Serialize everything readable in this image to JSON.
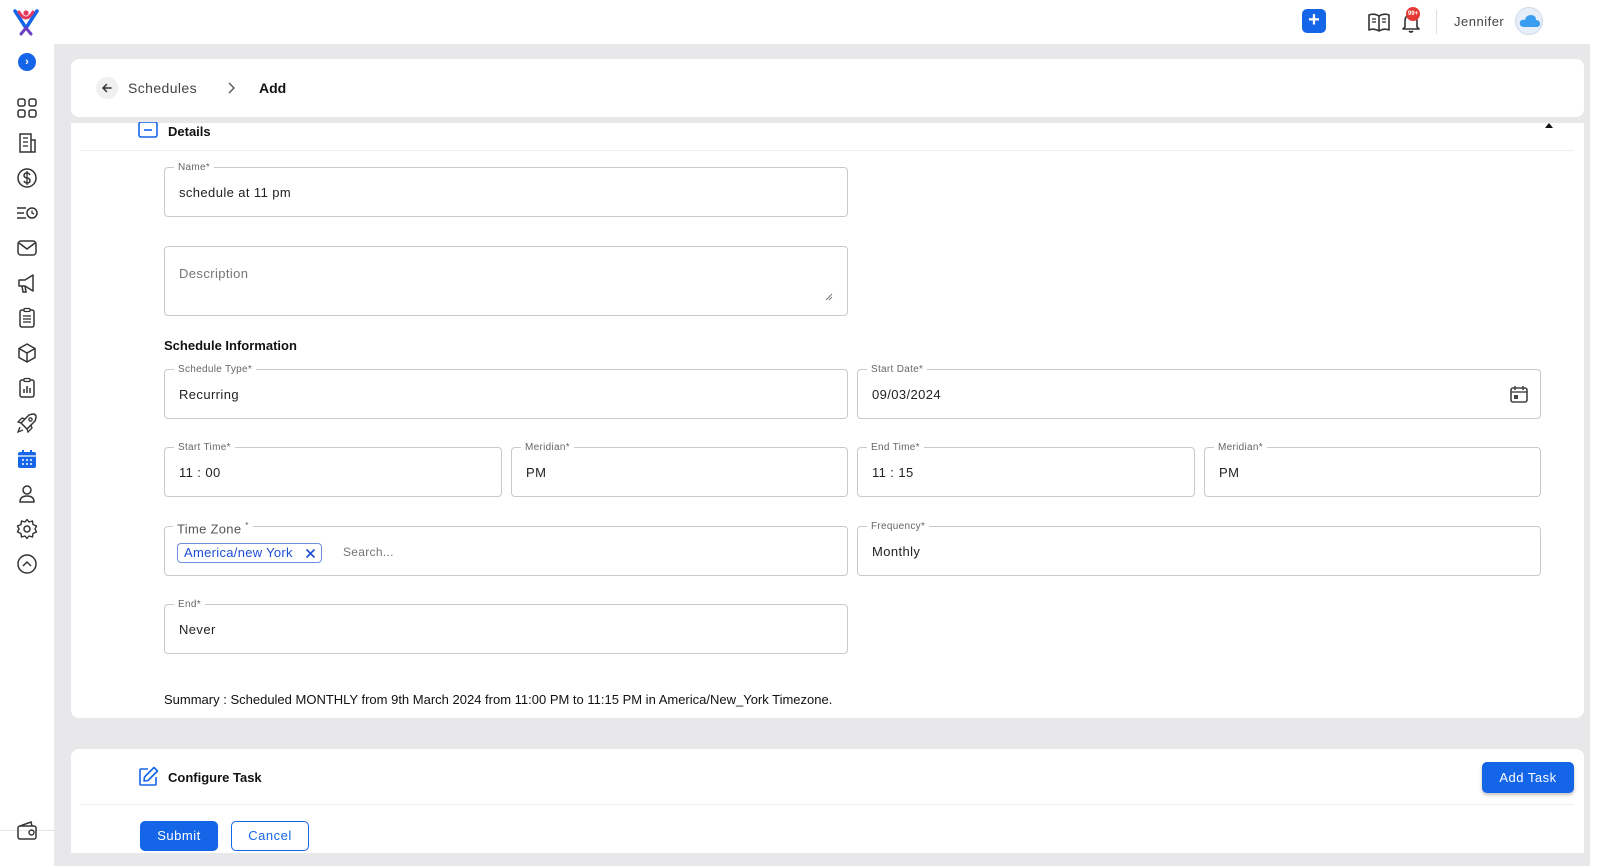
{
  "topbar": {
    "add_label": "+",
    "notification_badge": "99+",
    "username": "Jennifer"
  },
  "sidebar": {
    "expand_label": "›",
    "items": [
      {
        "icon": "dashboard-grid-icon"
      },
      {
        "icon": "building-icon"
      },
      {
        "icon": "dollar-icon"
      },
      {
        "icon": "list-clock-icon"
      },
      {
        "icon": "mail-icon"
      },
      {
        "icon": "megaphone-icon"
      },
      {
        "icon": "clipboard-list-icon"
      },
      {
        "icon": "cube-icon"
      },
      {
        "icon": "report-icon"
      },
      {
        "icon": "rocket-icon"
      },
      {
        "icon": "calendar-icon",
        "active": true
      },
      {
        "icon": "user-icon"
      },
      {
        "icon": "gear-icon"
      },
      {
        "icon": "chevron-up-circle-icon"
      },
      {
        "icon": "wallet-icon"
      }
    ]
  },
  "breadcrumb": {
    "parent": "Schedules",
    "current": "Add"
  },
  "details": {
    "title": "Details",
    "name_label": "Name*",
    "name_value": "schedule at 11 pm",
    "description_placeholder": "Description",
    "section_title": "Schedule Information",
    "schedule_type_label": "Schedule Type*",
    "schedule_type_value": "Recurring",
    "start_date_label": "Start Date*",
    "start_date_value": "09/03/2024",
    "start_time_label": "Start Time*",
    "start_time_value": "11 : 00",
    "start_meridian_label": "Meridian*",
    "start_meridian_value": "PM",
    "end_time_label": "End Time*",
    "end_time_value": "11 : 15",
    "end_meridian_label": "Meridian*",
    "end_meridian_value": "PM",
    "timezone_label": "Time Zone",
    "timezone_required": "*",
    "timezone_chip": "America/new York",
    "timezone_search_placeholder": "Search...",
    "frequency_label": "Frequency*",
    "frequency_value": "Monthly",
    "end_label": "End*",
    "end_value": "Never",
    "summary": "Summary : Scheduled MONTHLY from 9th March 2024 from 11:00 PM to 11:15 PM in America/New_York Timezone."
  },
  "configure": {
    "title": "Configure Task",
    "add_task_label": "Add Task",
    "submit_label": "Submit",
    "cancel_label": "Cancel"
  },
  "colors": {
    "primary": "#1565e8",
    "badge": "#e53935",
    "background": "#e8e8ea"
  }
}
